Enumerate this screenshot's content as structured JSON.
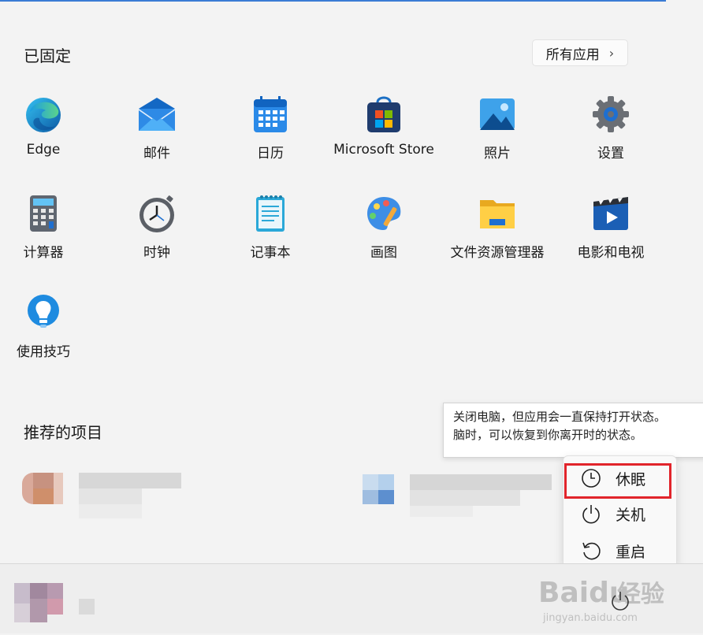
{
  "pinned": {
    "title": "已固定",
    "all_apps_label": "所有应用",
    "apps": [
      {
        "label": "Edge",
        "icon": "edge-icon"
      },
      {
        "label": "邮件",
        "icon": "mail-icon"
      },
      {
        "label": "日历",
        "icon": "calendar-icon"
      },
      {
        "label": "Microsoft Store",
        "icon": "store-icon"
      },
      {
        "label": "照片",
        "icon": "photos-icon"
      },
      {
        "label": "设置",
        "icon": "settings-gear-icon"
      },
      {
        "label": "计算器",
        "icon": "calculator-icon"
      },
      {
        "label": "时钟",
        "icon": "clock-icon"
      },
      {
        "label": "记事本",
        "icon": "notepad-icon"
      },
      {
        "label": "画图",
        "icon": "paint-palette-icon"
      },
      {
        "label": "文件资源管理器",
        "icon": "folder-icon"
      },
      {
        "label": "电影和电视",
        "icon": "movies-tv-icon"
      },
      {
        "label": "使用技巧",
        "icon": "tips-lightbulb-icon"
      }
    ]
  },
  "recommended": {
    "title": "推荐的项目"
  },
  "tooltip": {
    "line1": "关闭电脑，但应用会一直保持打开状态。",
    "line2": "脑时，可以恢复到你离开时的状态。"
  },
  "power_menu": {
    "items": [
      {
        "label": "休眠",
        "icon": "sleep-clock-icon"
      },
      {
        "label": "关机",
        "icon": "power-icon"
      },
      {
        "label": "重启",
        "icon": "restart-icon"
      }
    ],
    "highlight_color": "#e1242b"
  },
  "watermark": {
    "brand": "Baidu",
    "cn": "经验",
    "url": "jingyan.baidu.com"
  },
  "colors": {
    "background": "#f3f3f3",
    "accent": "#3a7bd5"
  }
}
